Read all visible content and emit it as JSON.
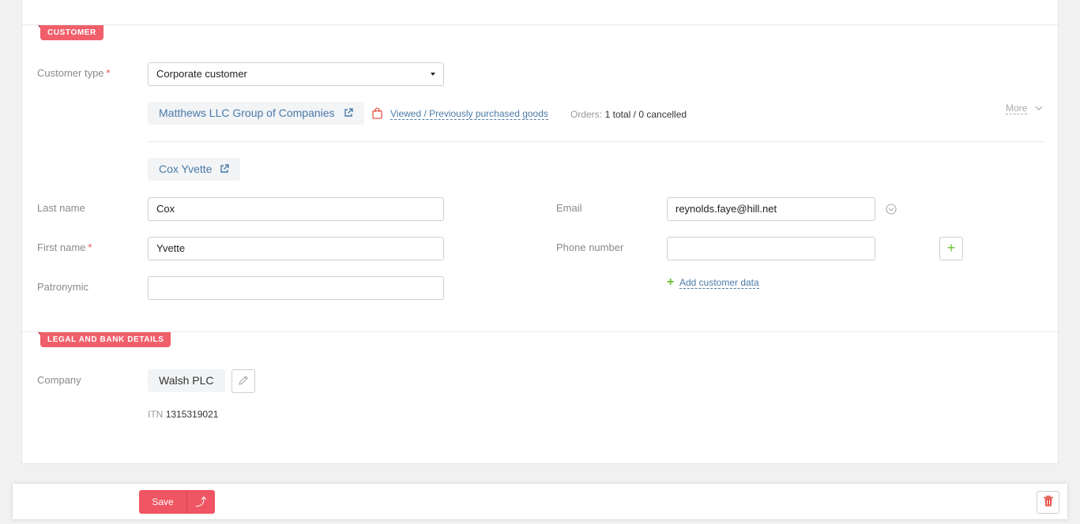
{
  "sections": {
    "customer_label": "Customer",
    "legal_label": "Legal and bank details"
  },
  "customer_type": {
    "label": "Customer type",
    "required_mark": "*",
    "value": "Corporate customer"
  },
  "corporate": {
    "company_name": "Matthews LLC Group of Companies",
    "viewed_link": "Viewed / Previously purchased goods",
    "orders_label": "Orders:",
    "orders_value": "1 total / 0 cancelled",
    "more_label": "More"
  },
  "contact": {
    "name": "Cox Yvette"
  },
  "fields": {
    "last_name_label": "Last name",
    "last_name_value": "Cox",
    "first_name_label": "First name",
    "first_name_required": "*",
    "first_name_value": "Yvette",
    "patronymic_label": "Patronymic",
    "patronymic_value": "",
    "email_label": "Email",
    "email_value": "reynolds.faye@hill.net",
    "phone_label": "Phone number",
    "phone_value": "",
    "add_customer_data": "Add customer data"
  },
  "legal": {
    "company_label": "Company",
    "company_value": "Walsh PLC",
    "itn_label": "ITN",
    "itn_value": "1315319021"
  },
  "footer": {
    "save_label": "Save",
    "save_arrow": "⤴"
  },
  "colors": {
    "accent": "#f05f6a",
    "link": "#4b7aa8",
    "plus": "#6cbf2f"
  },
  "icons": {
    "external_link": "external-link-icon",
    "bag": "shopping-bag-icon",
    "chevron": "chevron-down-icon",
    "check_circle": "check-circle-icon",
    "plus": "plus-icon",
    "pencil": "pencil-icon",
    "trash": "trash-icon"
  }
}
